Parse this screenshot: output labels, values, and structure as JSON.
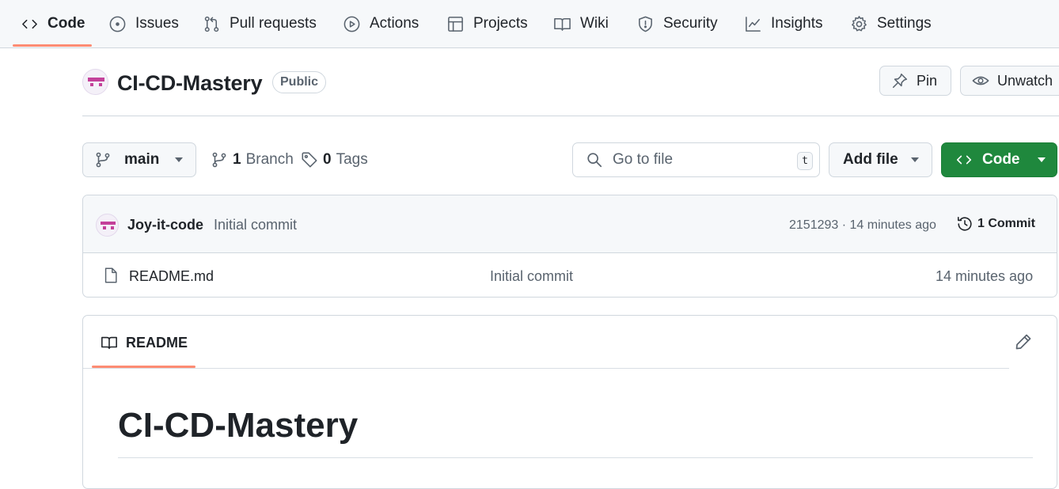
{
  "repo_nav": {
    "tabs": [
      {
        "label": "Code",
        "icon": "code-icon",
        "selected": true
      },
      {
        "label": "Issues",
        "icon": "issue-opened-icon"
      },
      {
        "label": "Pull requests",
        "icon": "git-pull-request-icon"
      },
      {
        "label": "Actions",
        "icon": "play-icon"
      },
      {
        "label": "Projects",
        "icon": "table-icon"
      },
      {
        "label": "Wiki",
        "icon": "book-icon"
      },
      {
        "label": "Security",
        "icon": "shield-icon"
      },
      {
        "label": "Insights",
        "icon": "graph-icon"
      },
      {
        "label": "Settings",
        "icon": "gear-icon"
      }
    ],
    "selected_accent": "#fd8c73"
  },
  "repo_header": {
    "name": "CI-CD-Mastery",
    "visibility": "Public",
    "pin_label": "Pin",
    "unwatch_label": "Unwatch"
  },
  "toolbar": {
    "branch": "main",
    "branch_count": "1",
    "branch_label": "Branch",
    "tag_count": "0",
    "tag_label": "Tags",
    "search_placeholder": "Go to file",
    "search_shortcut": "t",
    "add_file_label": "Add file",
    "code_button_label": "Code",
    "code_button_color": "#1f883d"
  },
  "latest_commit": {
    "author": "Joy-it-code",
    "message": "Initial commit",
    "sha_time": "2151293 · 14 minutes ago",
    "commit_count": "1 Commit"
  },
  "files": [
    {
      "name": "README.md",
      "message": "Initial commit",
      "time": "14 minutes ago",
      "icon": "file-icon"
    }
  ],
  "readme": {
    "tab_label": "README",
    "heading": "CI-CD-Mastery"
  }
}
